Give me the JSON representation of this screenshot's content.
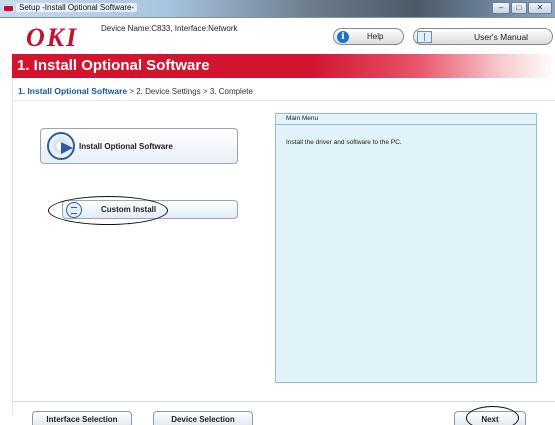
{
  "window": {
    "title": "Setup -Install Optional Software-"
  },
  "header": {
    "logo": "OKI",
    "device_info": "Device Name:C833, Interface:Network",
    "help_label": "Help",
    "manual_label": "User's Manual"
  },
  "banner": {
    "title": "1. Install Optional Software"
  },
  "breadcrumb": {
    "current": "1. Install Optional Software",
    "rest": " > 2. Device Settings > 3. Complete"
  },
  "options": {
    "install_label": "Install Optional Software",
    "custom_label": "Custom Install"
  },
  "info_panel": {
    "heading": "Main Menu",
    "description": "Install the driver and software to the PC."
  },
  "footer": {
    "interface_label": "Interface Selection",
    "device_label": "Device Selection",
    "next_label": "Next"
  },
  "colors": {
    "brand_red": "#c8102e",
    "banner_red": "#d2142f",
    "breadcrumb_blue": "#1a55a8",
    "panel_bg": "#dff3f8"
  }
}
